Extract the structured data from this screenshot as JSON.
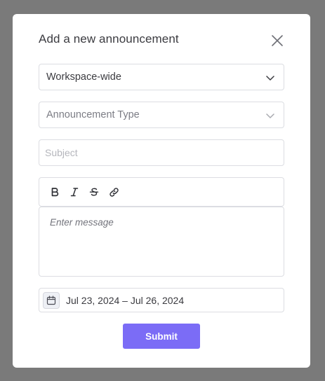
{
  "dialog": {
    "title": "Add a new announcement",
    "close_icon": "close-icon"
  },
  "scope_select": {
    "value": "Workspace-wide",
    "icon": "chevron-down-icon"
  },
  "type_select": {
    "placeholder": "Announcement Type",
    "icon": "chevron-down-icon"
  },
  "subject": {
    "value": "",
    "placeholder": "Subject"
  },
  "editor": {
    "toolbar": [
      {
        "name": "bold",
        "icon": "bold-icon"
      },
      {
        "name": "italic",
        "icon": "italic-icon"
      },
      {
        "name": "strikethrough",
        "icon": "strikethrough-icon"
      },
      {
        "name": "link",
        "icon": "link-icon"
      }
    ],
    "placeholder": "Enter message",
    "value": ""
  },
  "date_range": {
    "icon": "calendar-icon",
    "value": "Jul 23, 2024 – Jul 26, 2024"
  },
  "submit_label": "Submit",
  "colors": {
    "overlay": "#7a7a7a",
    "accent": "#7b6cf6",
    "border": "#dcdde2",
    "text": "#3b3b40"
  }
}
